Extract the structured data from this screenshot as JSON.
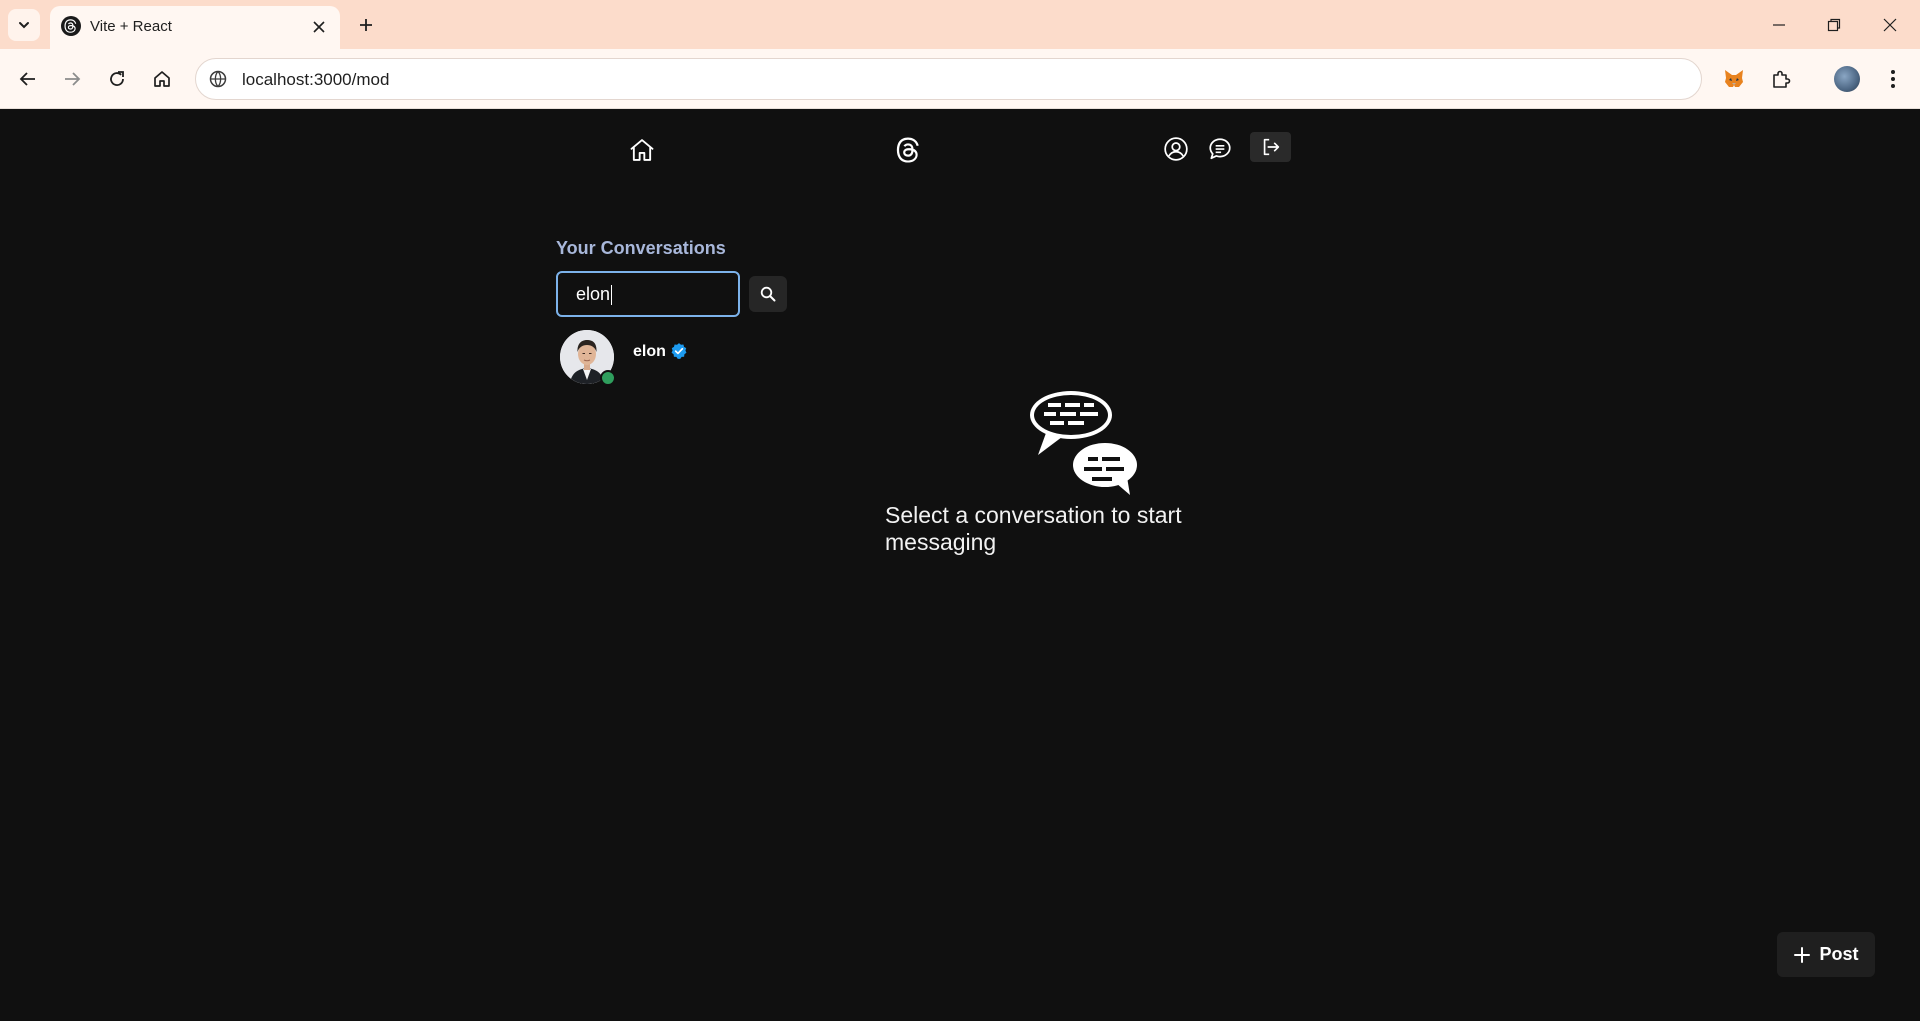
{
  "browser": {
    "tab_title": "Vite + React",
    "url": "localhost:3000/mod"
  },
  "nav": {
    "icons": [
      "home-icon",
      "threads-logo-icon",
      "user-profile-icon",
      "chat-icon",
      "logout-icon"
    ]
  },
  "conversations": {
    "title": "Your Conversations",
    "search_value": "elon",
    "items": [
      {
        "name": "elon",
        "verified": true,
        "online": true
      }
    ]
  },
  "empty_state": {
    "message": "Select a conversation to start messaging"
  },
  "post_button": {
    "label": "Post"
  },
  "colors": {
    "background": "#101010",
    "heading": "#a8b7da",
    "focus_border": "#7cb2ea",
    "verified_badge": "#1d9bf0",
    "online": "#2f9e5d"
  }
}
